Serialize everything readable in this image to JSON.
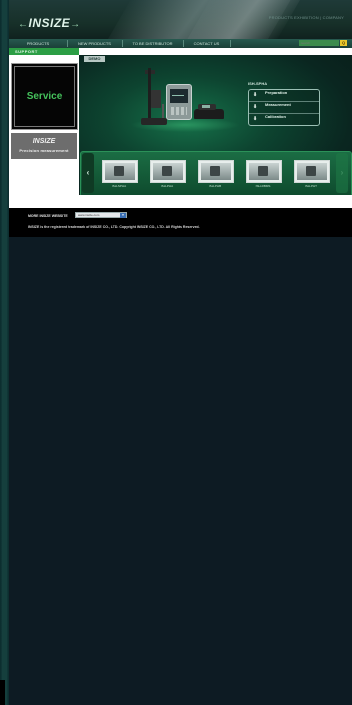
{
  "brand": {
    "logo_text": "INSIZE"
  },
  "header": {
    "top_links": "PRODUCTS EXHIBITION | COMPANY"
  },
  "nav": {
    "items": [
      "PRODUCTS",
      "NEW PRODUCTS",
      "TO BE DISTRIBUTOR",
      "CONTACT US"
    ],
    "search_placeholder": "search",
    "search_button": "Q"
  },
  "sidebar": {
    "section_label": "SUPPORT",
    "service_label": "Service",
    "promo_logo": "INSIZE",
    "promo_text": "Precision measurement"
  },
  "main": {
    "demo_label": "DEMO",
    "model_title": "ISH-SPHA",
    "menu": [
      "Preparation",
      "Measurement",
      "Calibration"
    ]
  },
  "thumbnails": {
    "prev": "‹",
    "next": "›",
    "labels": [
      "ISH-SPHA",
      "ISH-PHA",
      "ISH-PHB",
      "ISH-RBMS",
      "ISH-PHT"
    ]
  },
  "footer": {
    "more_label": "MORE INSIZE WEBSITE",
    "site_value": "www.insize.com",
    "copyright": "INSIZE is the registered trademark of INSIZE CO., LTD. Copyright INSIZE CO., LTD. All Rights Reserved."
  },
  "colors": {
    "accent_green": "#2c9e45",
    "service_text": "#45c25c",
    "background": "#0d1b23"
  }
}
